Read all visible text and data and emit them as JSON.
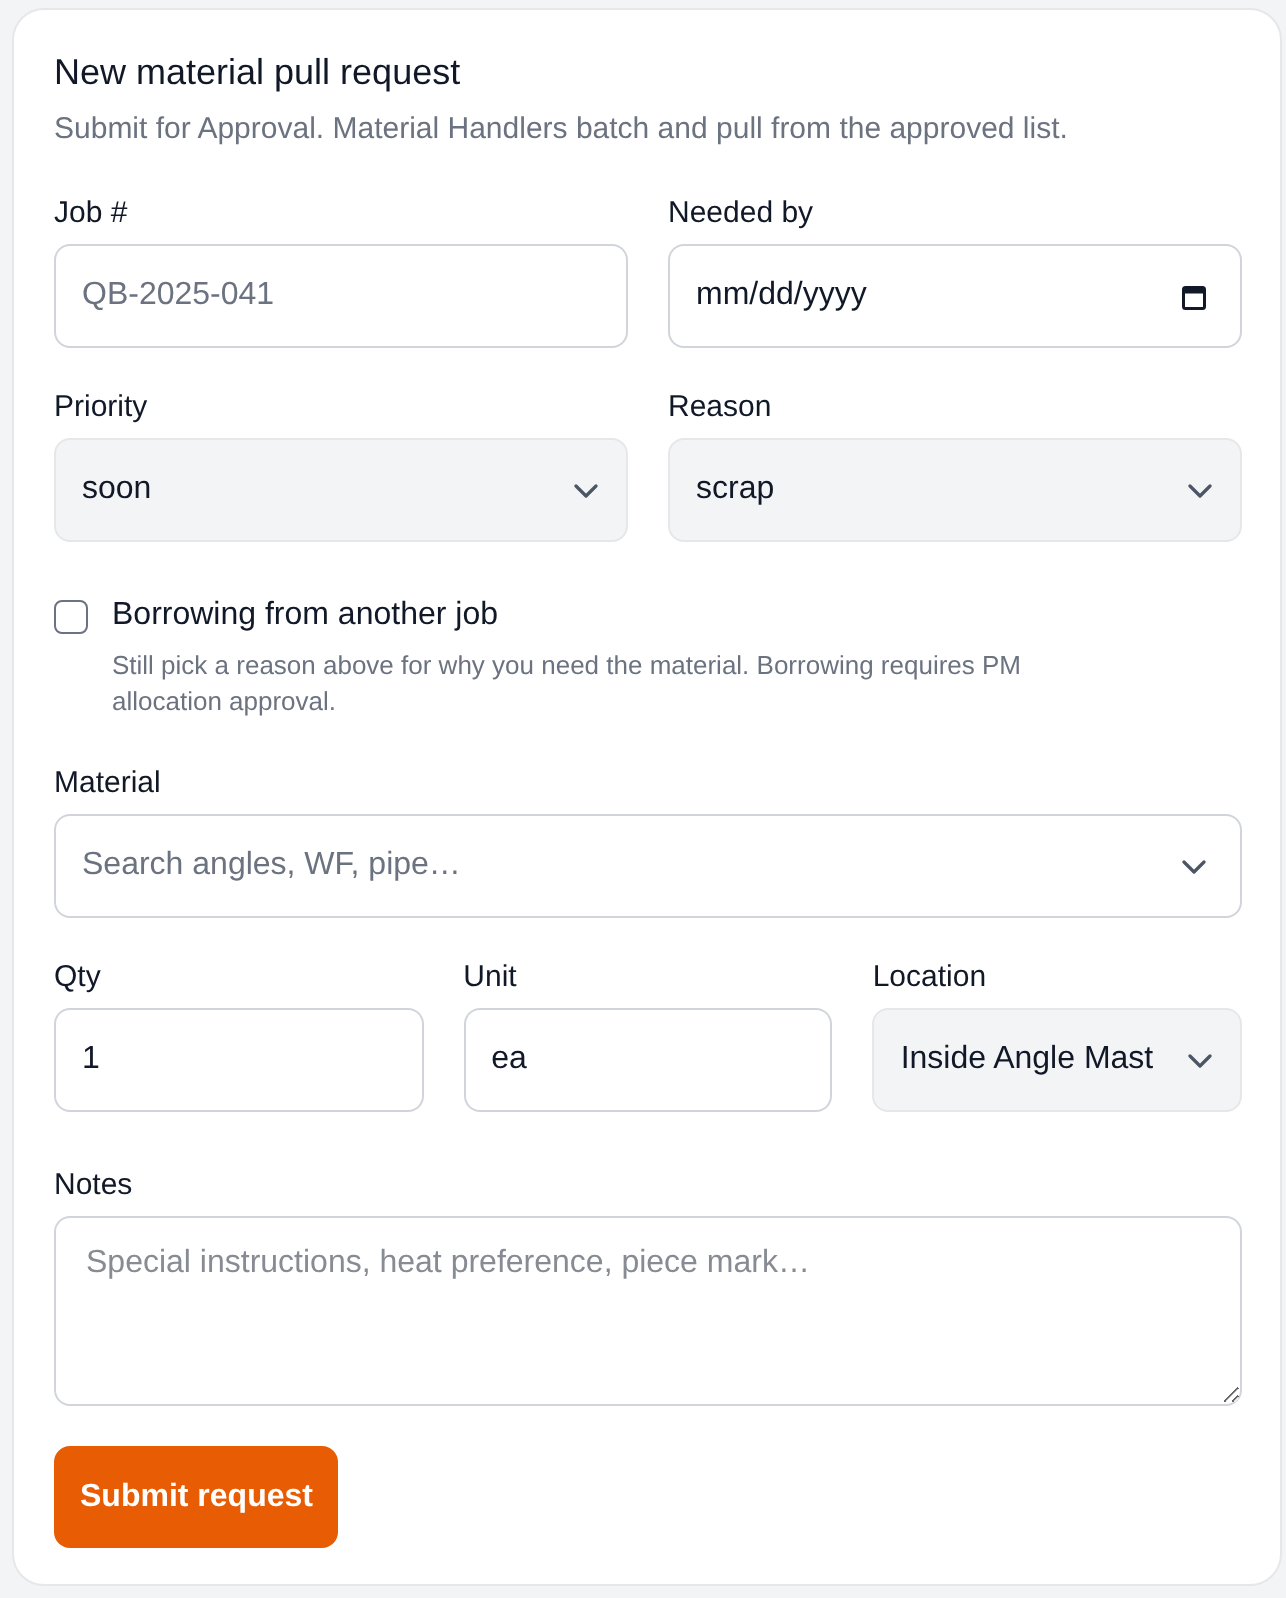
{
  "form": {
    "title": "New material pull request",
    "subtitle": "Submit for Approval. Material Handlers batch and pull from the approved list."
  },
  "row_1": [
    {
      "kind": "text",
      "label": "Job #",
      "placeholder": "QB-2025-041"
    },
    {
      "kind": "date",
      "label": "Needed by",
      "placeholder": "mm/dd/yyyy"
    }
  ],
  "row_2": [
    {
      "kind": "select",
      "label": "Priority",
      "value": "soon"
    },
    {
      "kind": "select",
      "label": "Reason",
      "value": "scrap"
    }
  ],
  "borrowing": {
    "label": "Borrowing from another job",
    "hint": "Still pick a reason above for why you need the material. Borrowing requires PM allocation approval.",
    "checked": false
  },
  "material": {
    "kind": "combobox",
    "label": "Material",
    "placeholder": "Search angles, WF, pipe…"
  },
  "row_3": [
    {
      "kind": "text",
      "label": "Qty",
      "value": "1"
    },
    {
      "kind": "text",
      "label": "Unit",
      "value": "ea"
    },
    {
      "kind": "select",
      "label": "Location",
      "value": "Inside Angle Mast"
    }
  ],
  "notes": {
    "kind": "textarea",
    "label": "Notes",
    "placeholder": "Special instructions, heat preference, piece mark…"
  },
  "submit_button": {
    "label": "Submit request"
  }
}
